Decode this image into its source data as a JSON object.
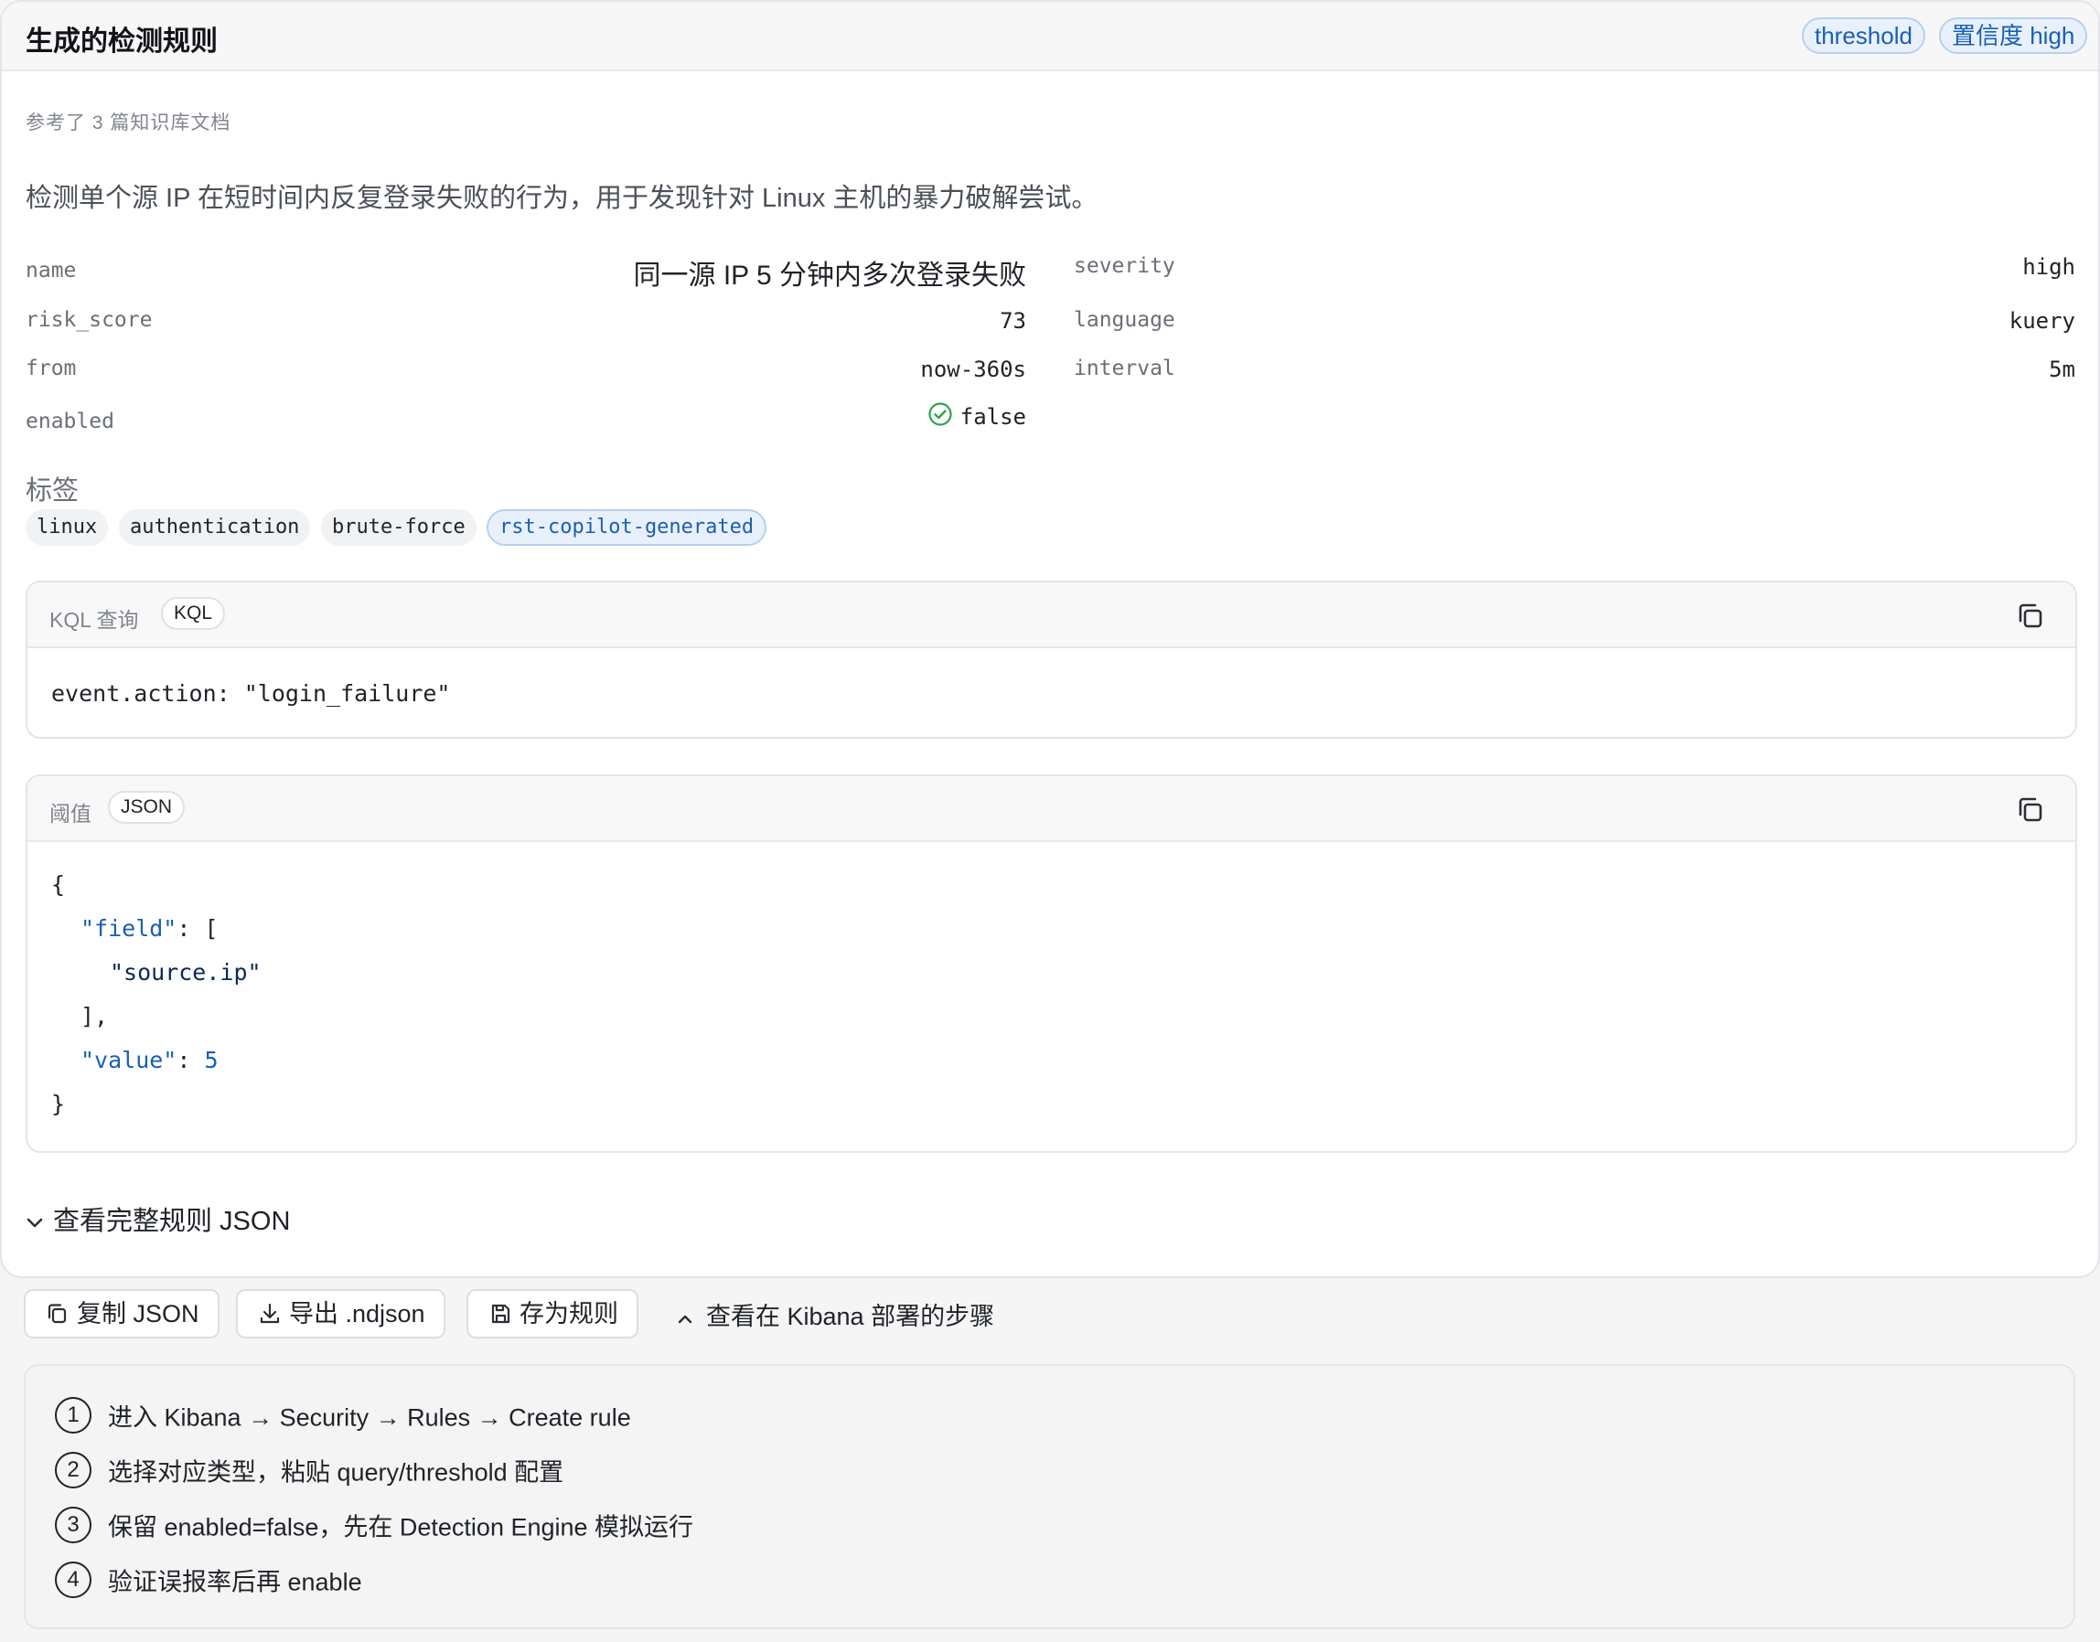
{
  "header": {
    "title": "生成的检测规则",
    "type_badge": "threshold",
    "confidence_badge": "置信度 high"
  },
  "references": "参考了 3 篇知识库文档",
  "description": "检测单个源 IP 在短时间内反复登录失败的行为，用于发现针对 Linux 主机的暴力破解尝试。",
  "fields": {
    "name_key": "name",
    "name_value": "同一源 IP 5 分钟内多次登录失败",
    "severity_key": "severity",
    "severity_value": "high",
    "risk_score_key": "risk_score",
    "risk_score_value": "73",
    "language_key": "language",
    "language_value": "kuery",
    "from_key": "from",
    "from_value": "now-360s",
    "interval_key": "interval",
    "interval_value": "5m",
    "enabled_key": "enabled",
    "enabled_value": "false"
  },
  "tags": {
    "label": "标签",
    "items": [
      "linux",
      "authentication",
      "brute-force",
      "rst-copilot-generated"
    ]
  },
  "query_block": {
    "label": "KQL 查询",
    "badge": "KQL",
    "code": "event.action: \"login_failure\""
  },
  "threshold_block": {
    "label": "阈值",
    "badge": "JSON",
    "lines": {
      "l1": "{",
      "l2_key": "\"field\"",
      "l2_rest": ": [",
      "l3_str": "\"source.ip\"",
      "l4": "],",
      "l5_key": "\"value\"",
      "l5_sep": ": ",
      "l5_num": "5",
      "l6": "}"
    }
  },
  "expander": "查看完整规则 JSON",
  "actions": {
    "copy_json": "复制 JSON",
    "export": "导出 .ndjson",
    "save": "存为规则",
    "deploy_steps": "查看在 Kibana 部署的步骤"
  },
  "steps": [
    {
      "num": "1",
      "text": "进入 Kibana → Security → Rules → Create rule"
    },
    {
      "num": "2",
      "text": "选择对应类型，粘贴 query/threshold 配置"
    },
    {
      "num": "3",
      "text": "保留 enabled=false，先在 Detection Engine 模拟运行"
    },
    {
      "num": "4",
      "text": "验证误报率后再 enable"
    }
  ],
  "colors": {
    "accent": "#1a5fb4",
    "success": "#2ea44f"
  }
}
